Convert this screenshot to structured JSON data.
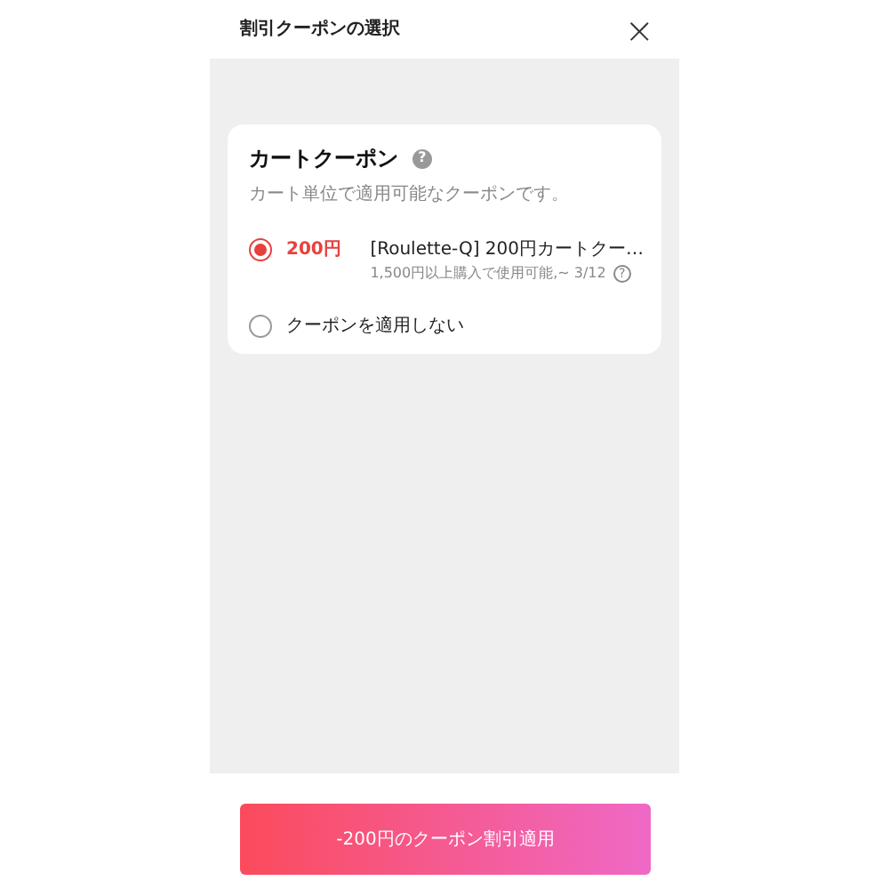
{
  "header": {
    "title": "割引クーポンの選択",
    "close": "×"
  },
  "section": {
    "title": "カートクーポン",
    "help": "?",
    "subtitle": "カート単位で適用可能なクーポンです。",
    "options": [
      {
        "label": "200円",
        "selected": true,
        "title": "[Roulette-Q] 200円カートクー…",
        "detail": "1,500円以上購入で使用可能,~ 3/12",
        "detail_help": "?"
      },
      {
        "label": "クーポンを適用しない",
        "selected": false
      }
    ]
  },
  "apply_button": "-200円のクーポン割引適用"
}
